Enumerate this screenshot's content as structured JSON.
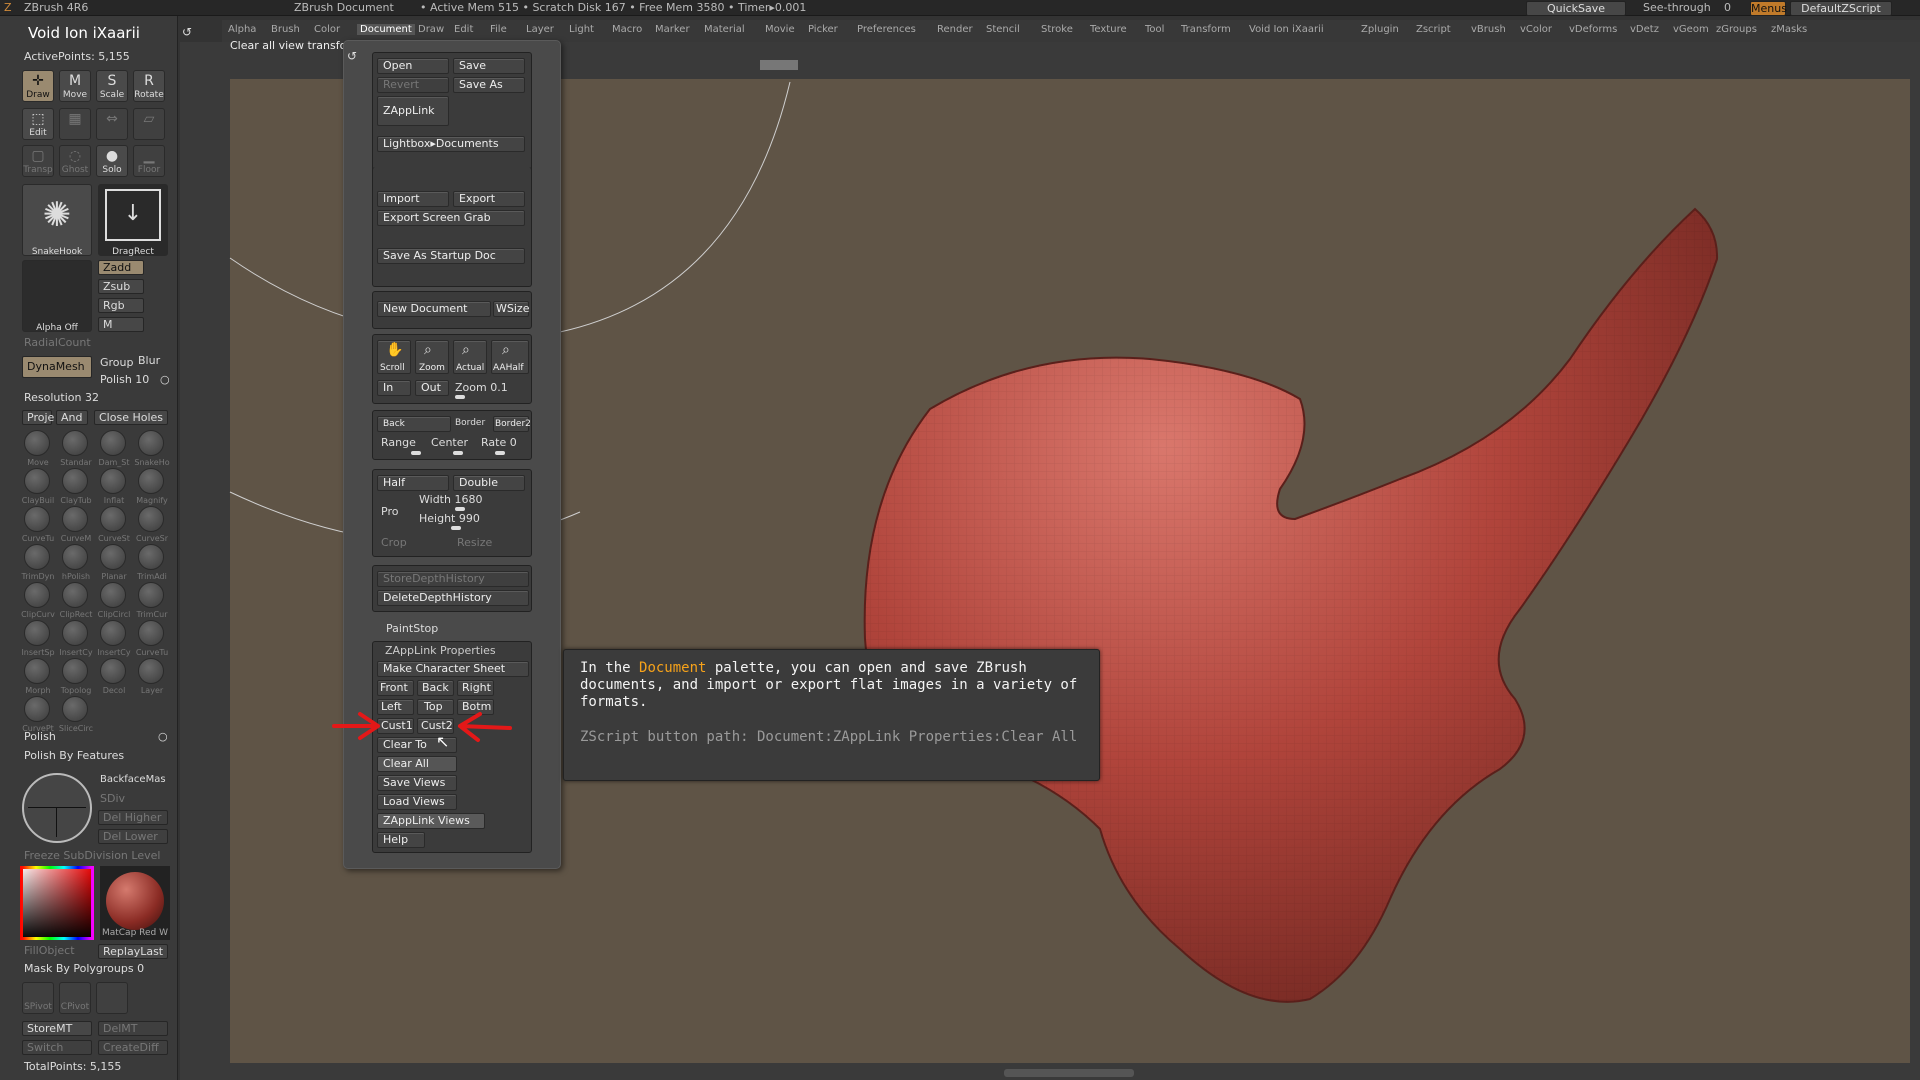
{
  "titlebar": {
    "app": "ZBrush 4R6",
    "doc": "ZBrush Document",
    "stats": "• Active Mem 515 • Scratch Disk 167 • Free Mem 3580 • Timer▸0.001",
    "quicksave": "QuickSave",
    "seethrough": "See-through",
    "seethrough_val": "0",
    "menus": "Menus",
    "default_script": "DefaultZScript"
  },
  "menubar": [
    "Alpha",
    "Brush",
    "Color",
    "Document",
    "Draw",
    "Edit",
    "File",
    "Layer",
    "Light",
    "Macro",
    "Marker",
    "Material",
    "Movie",
    "Picker",
    "Preferences",
    "Render",
    "Stencil",
    "Stroke",
    "Texture",
    "Tool",
    "Transform",
    "Void Ion iXaarii",
    "Zplugin",
    "Zscript",
    "vBrush",
    "vColor",
    "vDeforms",
    "vDetz",
    "vGeom",
    "zGroups",
    "zMasks"
  ],
  "hint": "Clear all view transforms to undefined.",
  "left": {
    "tool_name": "Void Ion iXaarii",
    "active_points": "ActivePoints: 5,155",
    "draw": "Draw",
    "move": "Move",
    "scale": "Scale",
    "rotate": "Rotate",
    "edit": "Edit",
    "solo": "Solo",
    "transp": "Transp",
    "ghost": "Ghost",
    "floor": "Floor",
    "snakehook": "SnakeHook",
    "dragrect": "DragRect",
    "zadd": "Zadd",
    "zsub": "Zsub",
    "rgb": "Rgb",
    "m": "M",
    "alpha_off": "Alpha Off",
    "radialcount": "RadialCount",
    "dynamesh": "DynaMesh",
    "group": "Group",
    "blur": "Blur",
    "polish_val": "Polish 10",
    "resolution": "Resolution 32",
    "proje": "Proje",
    "and": "And",
    "close_holes": "Close Holes",
    "brushes": [
      "Move",
      "Standar",
      "Dam_St",
      "SnakeHo",
      "ClayBuil",
      "ClayTub",
      "Inflat",
      "Magnify",
      "CurveTu",
      "CurveM",
      "CurveSt",
      "CurveSr",
      "TrimDyn",
      "hPolish",
      "Planar",
      "TrimAdi",
      "ClipCurv",
      "ClipRect",
      "ClipCircl",
      "TrimCur",
      "InsertSp",
      "InsertCy",
      "InsertCy",
      "CurveTu",
      "Morph",
      "Topolog",
      "Decol",
      "Layer",
      "CurvePt",
      "SliceCirc"
    ],
    "polish": "Polish",
    "polish_by_features": "Polish By Features",
    "backfacemask": "BackfaceMas",
    "sdiv": "SDiv",
    "del_higher": "Del Higher",
    "del_lower": "Del Lower",
    "freeze": "Freeze SubDivision Level",
    "matcap": "MatCap Red W",
    "fillobject": "FillObject",
    "replaylast": "ReplayLast",
    "mask_by_polygroups": "Mask By Polygroups 0",
    "spivot": "SPivot",
    "cpivot": "CPivot",
    "storemt": "StoreMT",
    "delmt": "DelMT",
    "switch": "Switch",
    "creatediff": "CreateDiff",
    "total_points": "TotalPoints: 5,155"
  },
  "palette": {
    "open": "Open",
    "save": "Save",
    "revert": "Revert",
    "save_as": "Save As",
    "zapplink": "ZAppLink",
    "lightbox": "Lightbox▸Documents",
    "import": "Import",
    "export": "Export",
    "export_screen_grab": "Export Screen Grab",
    "save_as_startup": "Save As Startup Doc",
    "new_document": "New Document",
    "wsize": "WSize",
    "scroll": "Scroll",
    "zoom": "Zoom",
    "actual": "Actual",
    "aahalf": "AAHalf",
    "in": "In",
    "out": "Out",
    "zoom_val": "Zoom 0.1",
    "back": "Back",
    "border": "Border",
    "border2": "Border2",
    "range": "Range",
    "center": "Center",
    "rate": "Rate 0",
    "half": "Half",
    "double": "Double",
    "pro": "Pro",
    "width": "Width 1680",
    "height": "Height 990",
    "crop": "Crop",
    "resize": "Resize",
    "store_depth": "StoreDepthHistory",
    "delete_depth": "DeleteDepthHistory",
    "paintstop": "PaintStop",
    "zapplink_props": "ZAppLink Properties",
    "make_sheet": "Make Character Sheet",
    "front": "Front",
    "back2": "Back",
    "right": "Right",
    "left": "Left",
    "top": "Top",
    "bottom": "Botm",
    "cust1": "Cust1",
    "cust2": "Cust2",
    "clear_to": "Clear To",
    "clear_all": "Clear All",
    "save_views": "Save Views",
    "load_views": "Load Views",
    "zapplink_views": "ZAppLink Views",
    "help": "Help"
  },
  "tooltip": {
    "pre": "In the ",
    "highlight": "Document",
    "post": " palette, you can open and save ZBrush documents, and import or export flat images in a variety of formats.",
    "path": "ZScript button path: Document:ZAppLink Properties:Clear All"
  },
  "colors": {
    "canvas": "#5f5446",
    "model": "#b0443b",
    "accent": "#f6a21a",
    "arrow": "#e41818"
  }
}
